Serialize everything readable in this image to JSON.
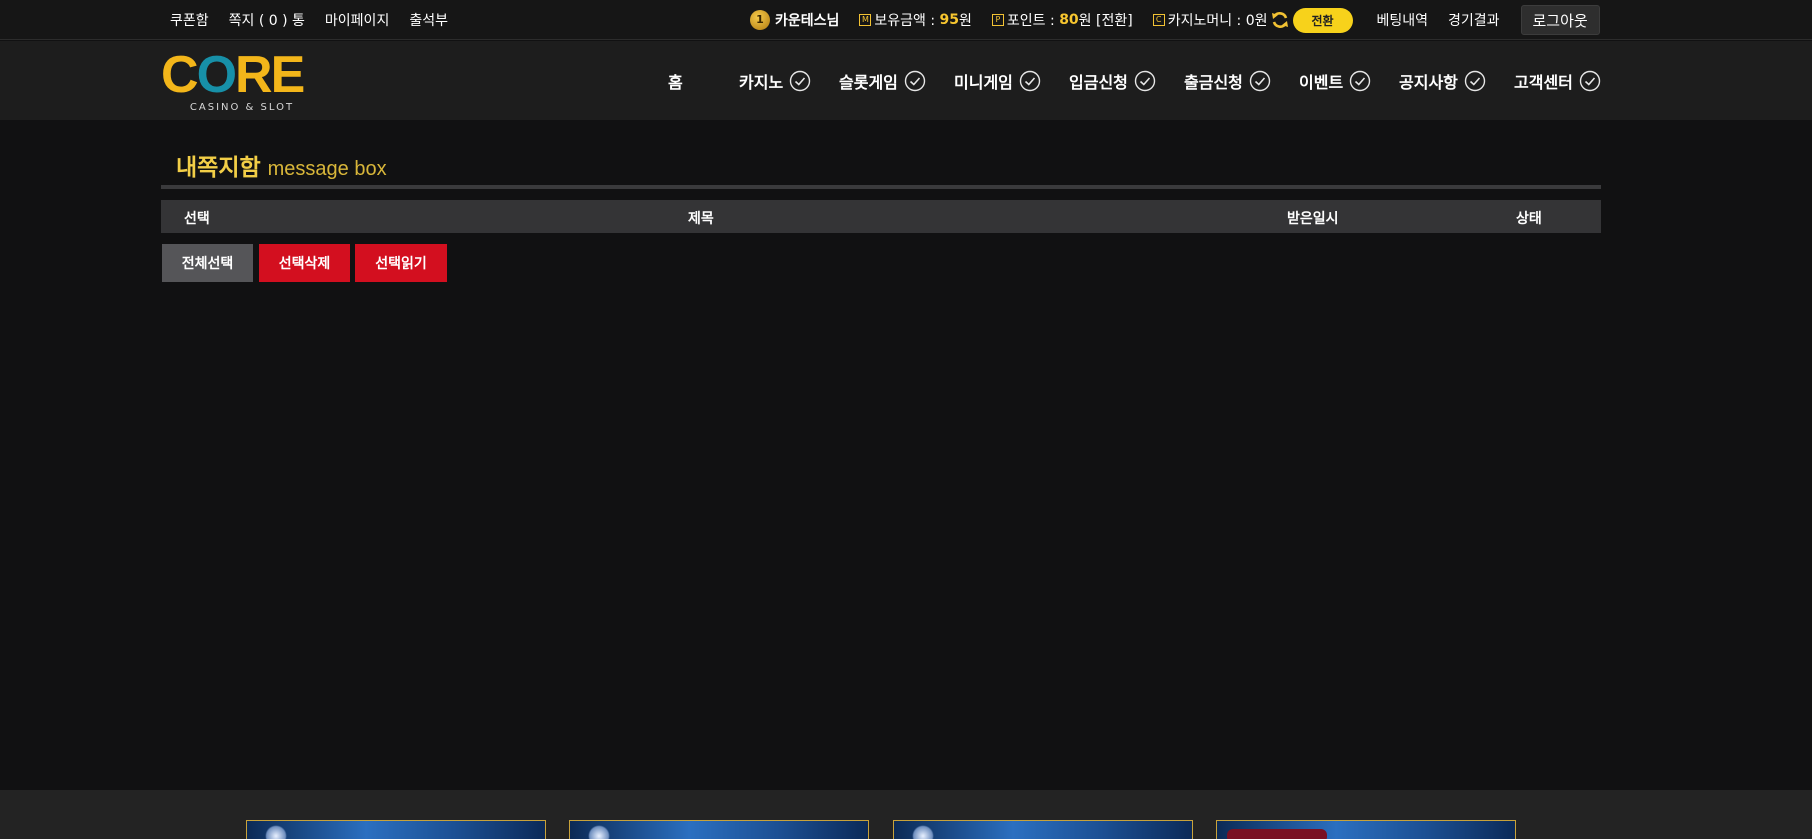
{
  "topbar": {
    "left_links": [
      "쿠폰함",
      "쪽지 ( 0 ) 통",
      "마이페이지",
      "출석부"
    ],
    "user_name": "카운테스님",
    "balance": {
      "label": "보유금액 :",
      "value": "95",
      "unit": "원"
    },
    "point": {
      "label": "포인트 :",
      "value": "80",
      "unit": "원 [전환]"
    },
    "casino_money": {
      "label": "카지노머니 :",
      "value": "0원"
    },
    "switch_label": "전환",
    "betting_history": "베팅내역",
    "match_results": "경기결과",
    "logout": "로그아웃"
  },
  "logo": {
    "text_c": "C",
    "text_o": "O",
    "text_re": "RE",
    "sub": "CASINO & SLOT"
  },
  "nav": [
    "홈",
    "카지노",
    "슬롯게임",
    "미니게임",
    "입금신청",
    "출금신청",
    "이벤트",
    "공지사항",
    "고객센터"
  ],
  "page": {
    "title_ko": "내쪽지함",
    "title_en": "message box",
    "columns": [
      "선택",
      "제목",
      "받은일시",
      "상태"
    ],
    "buttons": {
      "select_all": "전체선택",
      "delete_selected": "선택삭제",
      "read_selected": "선택읽기"
    }
  },
  "colors": {
    "accent_yellow": "#f7c62f",
    "red_button": "#d30f1f",
    "gray_button": "#555558"
  }
}
